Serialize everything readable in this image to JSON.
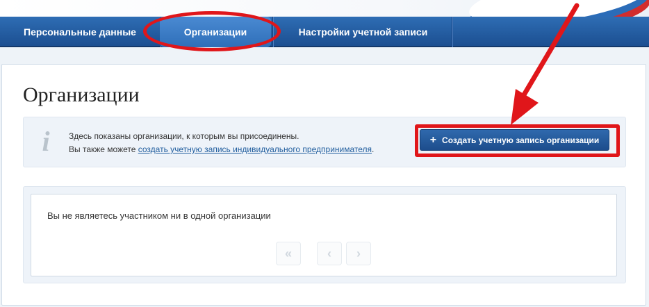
{
  "nav": {
    "items": [
      {
        "label": "Персональные данные"
      },
      {
        "label": "Организации"
      },
      {
        "label": "Настройки учетной записи"
      }
    ]
  },
  "page": {
    "title": "Организации"
  },
  "info": {
    "line1": "Здесь показаны организации, к которым вы присоединены.",
    "line2_prefix": "Вы также можете ",
    "line2_link": "создать учетную запись индивидуального предпринимателя",
    "line2_suffix": ".",
    "icon": "info-icon",
    "icon_glyph": "i"
  },
  "create_button": {
    "plus": "+",
    "label": "Создать учетную запись организации"
  },
  "list": {
    "empty_message": "Вы не являетесь участником ни в одной организации"
  },
  "pagination": {
    "first": "«",
    "prev": "‹",
    "next": "›"
  },
  "colors": {
    "nav_blue": "#1c4f91",
    "highlight_red": "#e0161a",
    "button_blue": "#2f69ad"
  }
}
